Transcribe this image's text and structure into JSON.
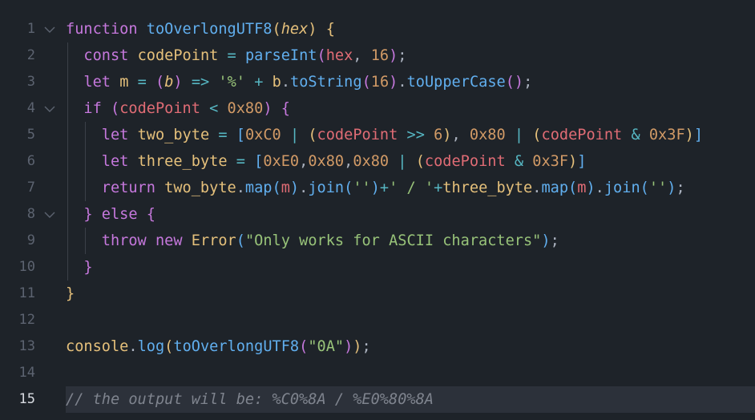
{
  "editor": {
    "language": "javascript",
    "active_line": 15,
    "fold_icon": "chevron-down-icon",
    "lines": [
      {
        "num": "1",
        "text": "function toOverlongUTF8(hex) {",
        "fold": true
      },
      {
        "num": "2",
        "text": "  const codePoint = parseInt(hex, 16);"
      },
      {
        "num": "3",
        "text": "  let m = (b) => '%' + b.toString(16).toUpperCase();"
      },
      {
        "num": "4",
        "text": "  if (codePoint < 0x80) {",
        "fold": true
      },
      {
        "num": "5",
        "text": "    let two_byte = [0xC0 | (codePoint >> 6), 0x80 | (codePoint & 0x3F)]"
      },
      {
        "num": "6",
        "text": "    let three_byte = [0xE0,0x80,0x80 | (codePoint & 0x3F)]"
      },
      {
        "num": "7",
        "text": "    return two_byte.map(m).join('')+' / '+three_byte.map(m).join('');"
      },
      {
        "num": "8",
        "text": "  } else {",
        "fold": true
      },
      {
        "num": "9",
        "text": "    throw new Error(\"Only works for ASCII characters\");"
      },
      {
        "num": "10",
        "text": "  }"
      },
      {
        "num": "11",
        "text": "}"
      },
      {
        "num": "12",
        "text": ""
      },
      {
        "num": "13",
        "text": "console.log(toOverlongUTF8(\"0A\"));"
      },
      {
        "num": "14",
        "text": ""
      },
      {
        "num": "15",
        "text": "// the output will be: %C0%8A / %E0%80%8A"
      }
    ]
  }
}
